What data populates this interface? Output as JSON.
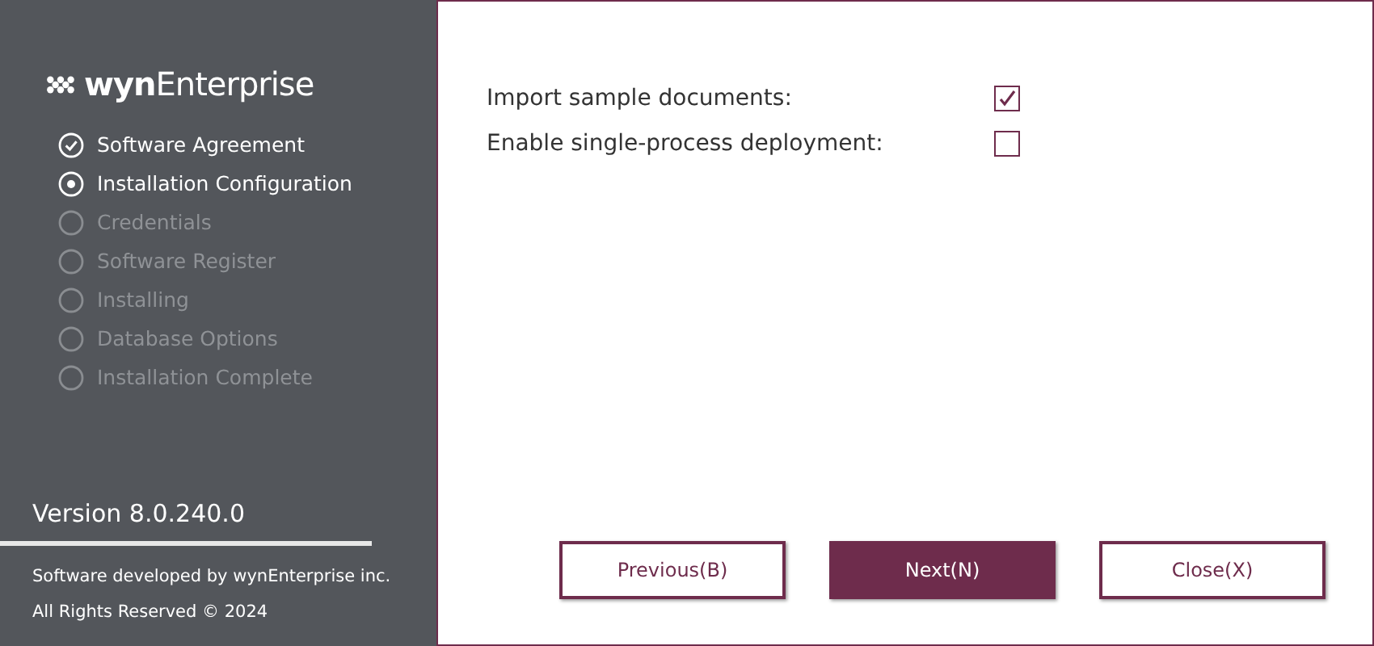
{
  "sidebar": {
    "logo": {
      "brand": "wyn",
      "product": "Enterprise"
    },
    "steps": [
      {
        "label": "Software Agreement",
        "kind": "done"
      },
      {
        "label": "Installation Configuration",
        "kind": "current"
      },
      {
        "label": "Credentials",
        "kind": "pending"
      },
      {
        "label": "Software Register",
        "kind": "pending"
      },
      {
        "label": "Installing",
        "kind": "pending"
      },
      {
        "label": "Database Options",
        "kind": "pending"
      },
      {
        "label": "Installation Complete",
        "kind": "pending"
      }
    ],
    "version": "Version 8.0.240.0",
    "developer": "Software developed by wynEnterprise inc.",
    "copyright": "All Rights Reserved © 2024"
  },
  "options": [
    {
      "label": "Import sample documents:",
      "checked": true
    },
    {
      "label": "Enable single-process deployment:",
      "checked": false
    }
  ],
  "buttons": [
    {
      "label": "Previous(B)",
      "kind": "secondary"
    },
    {
      "label": "Next(N)",
      "kind": "primary"
    },
    {
      "label": "Close(X)",
      "kind": "secondary"
    }
  ]
}
